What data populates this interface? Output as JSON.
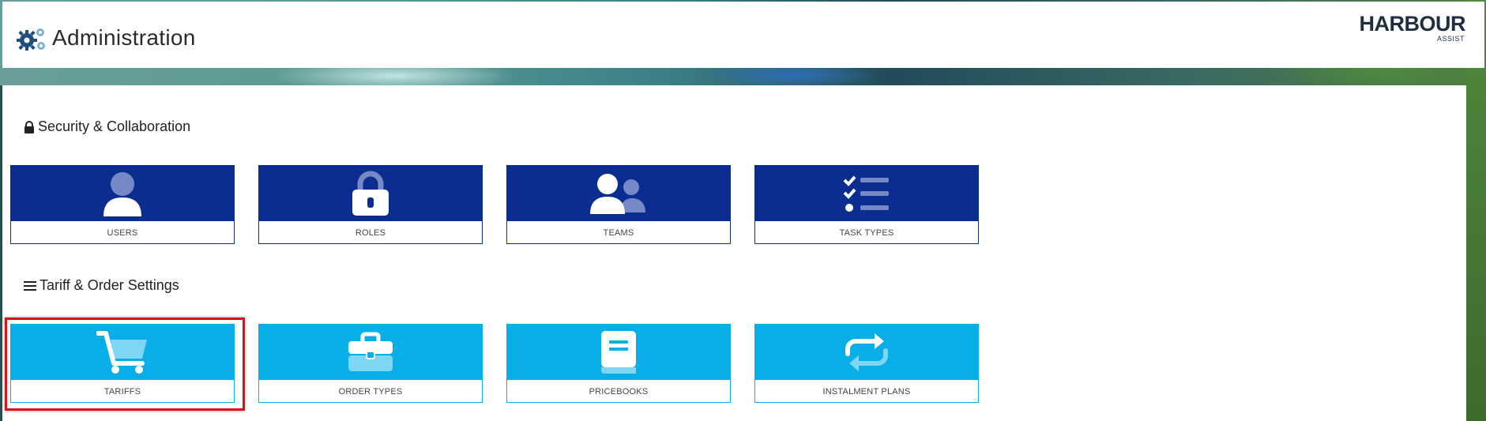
{
  "header": {
    "title": "Administration",
    "logo_main": "HARBOUR",
    "logo_sub": "ASSIST"
  },
  "sections": [
    {
      "title": "Security & Collaboration",
      "icon": "lock-icon",
      "tiles": [
        {
          "label": "USERS",
          "icon": "user-icon"
        },
        {
          "label": "ROLES",
          "icon": "padlock-icon"
        },
        {
          "label": "TEAMS",
          "icon": "team-icon"
        },
        {
          "label": "TASK TYPES",
          "icon": "checklist-icon"
        }
      ]
    },
    {
      "title": "Tariff & Order Settings",
      "icon": "list-icon",
      "tiles": [
        {
          "label": "TARIFFS",
          "icon": "cart-icon"
        },
        {
          "label": "ORDER TYPES",
          "icon": "briefcase-icon"
        },
        {
          "label": "PRICEBOOKS",
          "icon": "book-icon"
        },
        {
          "label": "INSTALMENT PLANS",
          "icon": "repeat-icon"
        }
      ]
    }
  ],
  "colors": {
    "security_tile": "#0b2d8f",
    "tariff_tile": "#08aee8",
    "highlight": "#d9131b"
  }
}
